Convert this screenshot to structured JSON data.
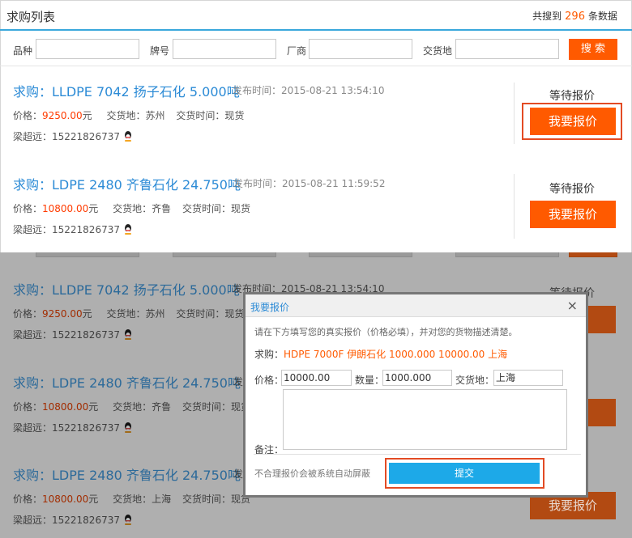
{
  "header": {
    "title": "求购列表",
    "count_prefix": "共搜到",
    "count": "296",
    "count_suffix": "条数据"
  },
  "filters": {
    "variety_label": "品种",
    "grade_label": "牌号",
    "maker_label": "厂商",
    "delivery_label": "交货地",
    "search_label": "搜 索"
  },
  "listings": [
    {
      "title": "求购：LLDPE 7042 扬子石化 5.000吨",
      "date": "发布时间：2015-08-21 13:54:10",
      "price_label": "价格：",
      "price": "9250.00",
      "unit": "元",
      "place": "交货地：苏州",
      "time": "交货时间：现货",
      "contact": "梁超远：15221826737",
      "status": "等待报价",
      "button": "我要报价"
    },
    {
      "title": "求购：LDPE 2480 齐鲁石化 24.750吨",
      "date": "发布时间：2015-08-21 11:59:52",
      "price_label": "价格：",
      "price": "10800.00",
      "unit": "元",
      "place": "交货地：齐鲁",
      "time": "交货时间：现货",
      "contact": "梁超远：15221826737",
      "status": "等待报价",
      "button": "我要报价"
    }
  ],
  "dimmed_listings": [
    {
      "title": "求购：LLDPE 7042 扬子石化 5.000吨",
      "date": "发布时间：2015-08-21 13:54:10",
      "price_label": "价格：",
      "price": "9250.00",
      "unit": "元",
      "place": "交货地：苏州",
      "time": "交货时间：现货",
      "contact": "梁超远：15221826737",
      "status": "等待报价",
      "button": "报价"
    },
    {
      "title": "求购：LDPE 2480 齐鲁石化 24.750吨",
      "date": "发",
      "price_label": "价格：",
      "price": "10800.00",
      "unit": "元",
      "place": "交货地：齐鲁",
      "time": "交货时间：现货",
      "contact": "梁超远：15221826737",
      "status": "",
      "button": "价"
    },
    {
      "title": "求购：LDPE 2480 齐鲁石化 24.750吨",
      "date": "发",
      "price_label": "价格：",
      "price": "10800.00",
      "unit": "元",
      "place": "交货地：上海",
      "time": "交货时间：现货",
      "contact": "梁超远：15221826737",
      "status": "",
      "button": "我要报价"
    }
  ],
  "modal": {
    "title": "我要报价",
    "close": "×",
    "hint": "请在下方填写您的真实报价（价格必填），并对您的货物描述清楚。",
    "item_label": "求购：",
    "item_value": "HDPE 7000F 伊朗石化 1000.000 10000.00 上海",
    "price_label": "价格：",
    "price_value": "10000.00",
    "qty_label": "数量：",
    "qty_value": "1000.000",
    "place_label": "交货地：",
    "place_value": "上海",
    "remark_label": "备注：",
    "note": "不合理报价会被系统自动屏蔽",
    "submit": "提交"
  },
  "colors": {
    "accent_orange": "#ff5a00",
    "link_blue": "#2c8bd6",
    "submit_blue": "#1da9e8",
    "highlight_red": "#e34b24"
  }
}
